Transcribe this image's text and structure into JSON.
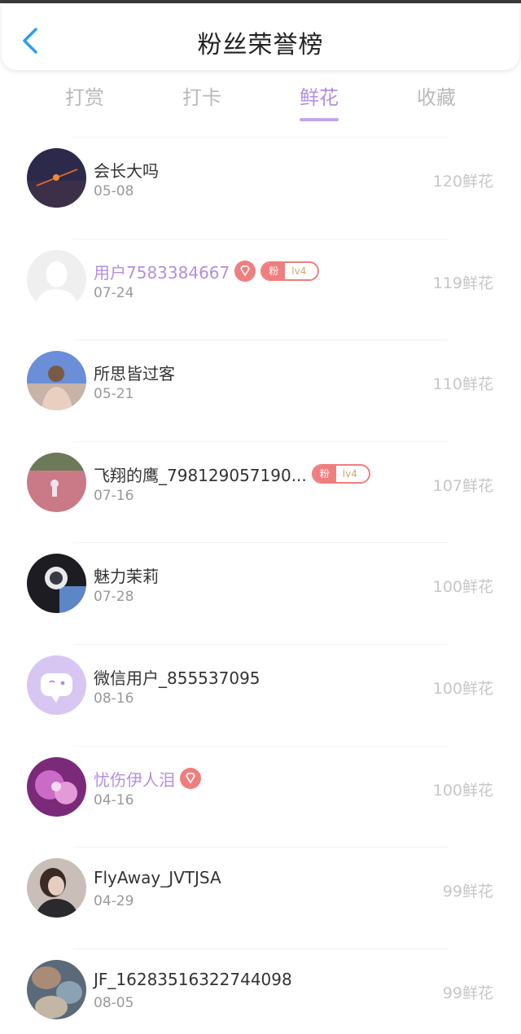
{
  "header": {
    "title": "粉丝荣誉榜"
  },
  "tabs": [
    {
      "label": "打赏",
      "active": false
    },
    {
      "label": "打卡",
      "active": false
    },
    {
      "label": "鲜花",
      "active": true
    },
    {
      "label": "收藏",
      "active": false
    }
  ],
  "colors": {
    "accent": "#b48ee0",
    "badge": "#ef7e7e"
  },
  "fans": [
    {
      "name": "会长大吗",
      "date": "05-08",
      "count": "120鲜花"
    },
    {
      "name": "用户7583384667",
      "date": "07-24",
      "count": "119鲜花",
      "fan_label": "粉",
      "level": "lv4"
    },
    {
      "name": "所思皆过客",
      "date": "05-21",
      "count": "110鲜花"
    },
    {
      "name": "飞翔的鹰_798129057190...",
      "date": "07-16",
      "count": "107鲜花",
      "fan_label": "粉",
      "level": "lv4"
    },
    {
      "name": "魅力茉莉",
      "date": "07-28",
      "count": "100鲜花"
    },
    {
      "name": "微信用户_855537095",
      "date": "08-16",
      "count": "100鲜花"
    },
    {
      "name": "忧伤伊人泪",
      "date": "04-16",
      "count": "100鲜花"
    },
    {
      "name": "FlyAway_JVTJSA",
      "date": "04-29",
      "count": "99鲜花"
    },
    {
      "name": "JF_16283516322744098",
      "date": "08-05",
      "count": "99鲜花"
    }
  ]
}
